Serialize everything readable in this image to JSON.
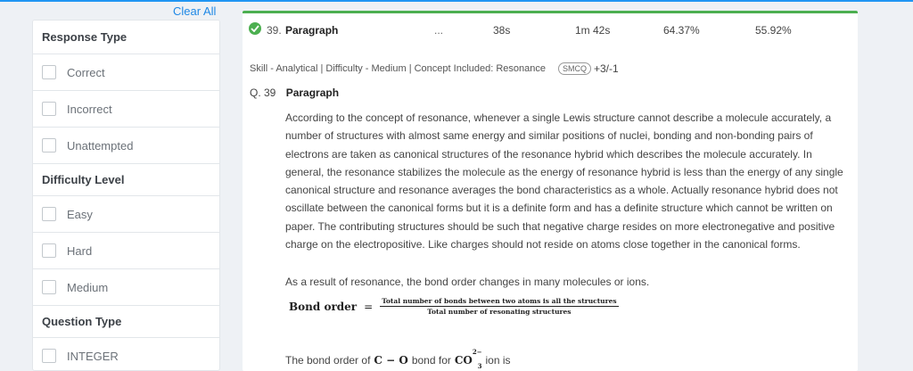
{
  "sidebar": {
    "clear_all": "Clear All",
    "groups": {
      "response": {
        "title": "Response Type",
        "options": [
          "Correct",
          "Incorrect",
          "Unattempted"
        ]
      },
      "difficulty": {
        "title": "Difficulty Level",
        "options": [
          "Easy",
          "Hard",
          "Medium"
        ]
      },
      "qtype": {
        "title": "Question Type",
        "options": [
          "INTEGER"
        ]
      }
    }
  },
  "summary": {
    "number": "39.",
    "type": "Paragraph",
    "ellipsis": "...",
    "time_you": "38s",
    "time_avg": "1m 42s",
    "pct1": "64.37%",
    "pct2": "55.92%",
    "status_color": "#4caf50"
  },
  "meta": {
    "text": "Skill - Analytical | Difficulty - Medium | Concept Included: Resonance",
    "badge": "SMCQ",
    "marks": "+3/-1"
  },
  "question": {
    "label": "Q. 39",
    "type": "Paragraph",
    "paragraph": "According to the concept of resonance, whenever a single Lewis structure cannot describe a molecule accurately, a number of structures with almost same energy and similar positions of nuclei, bonding and non-bonding pairs of electrons are taken as canonical structures of the resonance hybrid which describes the molecule accurately. In general, the resonance stabilizes the molecule as the energy of resonance hybrid is less than the energy of any single canonical structure and resonance averages the bond characteristics as a whole. Actually resonance hybrid does not oscillate between the canonical forms but it is a definite form and has a definite structure which cannot be written on paper. The contributing structures should be such that negative charge resides on more electronegative and positive charge on the electropositive. Like charges should not reside on atoms close together in the canonical forms.",
    "paragraph2": "As a result of resonance, the bond order changes in many molecules or ions.",
    "formula_lhs": "Bond order",
    "formula_eq": "=",
    "formula_num": "Total number of bonds between two atoms is all the structures",
    "formula_den": "Total number of resonating structures",
    "ask_prefix": "The bond order of",
    "ask_bond": "C − O",
    "ask_mid": "bond for",
    "ask_ion_base": "CO",
    "ask_ion_charge": "2−",
    "ask_ion_sub": "3",
    "ask_suffix": "ion is"
  }
}
